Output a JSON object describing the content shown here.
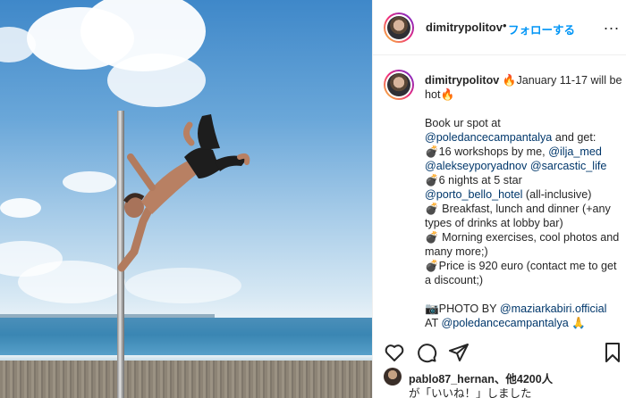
{
  "header": {
    "username": "dimitrypolitov",
    "separator": "•",
    "follow_label": "フォローする",
    "more_label": "..."
  },
  "caption": {
    "username": "dimitrypolitov",
    "line1": "🔥January 11-17 will be hot🔥",
    "book": "Book ur spot at",
    "mention_camp": "@poledancecampantalya",
    "and_get": " and get:",
    "bullet1_pre": "💣16 workshops by me, ",
    "mention_ilja": "@ilja_med",
    "mention_alekseyporyadnov": "@alekseyporyadnov",
    "mention_sarcastic": "@sarcastic_life",
    "bullet2": "💣6 nights at 5 star",
    "mention_porto": "@porto_bello_hotel",
    "all_inclusive": " (all-inclusive)",
    "bullet3": "💣 Breakfast, lunch and dinner (+any types of drinks at lobby bar)",
    "bullet4": "💣 Morning exercises, cool photos and many more;)",
    "bullet5": "💣Price is 920 euro (contact me to get a discount;)",
    "photo_by": "📷PHOTO BY ",
    "mention_maziar": "@maziarkabiri.official",
    "at": "AT ",
    "mention_camp2": "@poledancecampantalya",
    "pray": " 🙏"
  },
  "actions": {
    "like_icon": "heart-icon",
    "comment_icon": "comment-icon",
    "share_icon": "paper-plane-icon",
    "save_icon": "bookmark-icon"
  },
  "likes": {
    "user": "pablo87_hernan",
    "others": "、他4200人",
    "line2": "が「いいね！」しました"
  }
}
